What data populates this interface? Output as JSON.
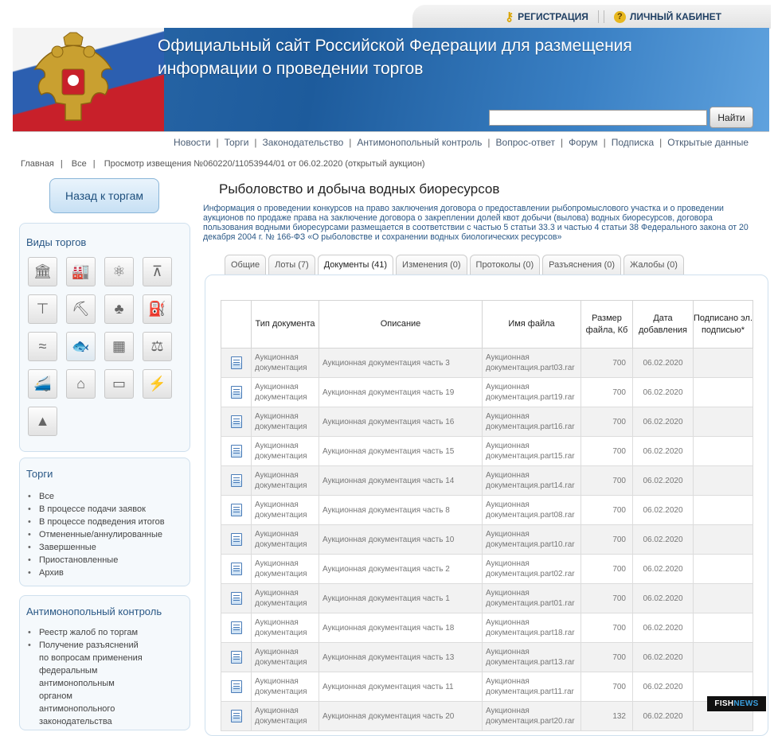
{
  "topbar": {
    "register": "РЕГИСТРАЦИЯ",
    "cabinet": "ЛИЧНЫЙ КАБИНЕТ"
  },
  "header": {
    "title_line1": "Официальный сайт Российской Федерации для размещения",
    "title_line2": "информации о проведении торгов",
    "search_button": "Найти"
  },
  "nav": [
    "Новости",
    "Торги",
    "Законодательство",
    "Антимонопольный контроль",
    "Вопрос-ответ",
    "Форум",
    "Подписка",
    "Открытые данные"
  ],
  "breadcrumb": [
    "Главная",
    "Все",
    "Просмотр извещения №060220/11053944/01 от 06.02.2020 (открытый аукцион)"
  ],
  "sidebar": {
    "back": "Назад к торгам",
    "types_title": "Виды торгов",
    "icons": [
      "building-icon",
      "factory-icon",
      "atom-icon",
      "surveyor-icon",
      "crane-icon",
      "miner-icon",
      "forest-icon",
      "oil-pump-icon",
      "water-icon",
      "fish-icon",
      "office-icon",
      "justice-icon",
      "train-icon",
      "house-icon",
      "billboard-icon",
      "power-line-icon",
      "antenna-icon"
    ],
    "torgi_title": "Торги",
    "torgi": [
      "Все",
      "В процессе подачи заявок",
      "В процессе подведения итогов",
      "Отмененные/аннулированные",
      "Завершенные",
      "Приостановленные",
      "Архив"
    ],
    "anti_title": "Антимонопольный контроль",
    "anti": [
      "Реестр жалоб по торгам",
      "Получение разъяснений по вопросам применения федеральным антимонопольным органом антимонопольного законодательства"
    ]
  },
  "main": {
    "title": "Рыболовство и добыча водных биоресурсов",
    "info": "Информация о проведении конкурсов на право заключения договора о предоставлении рыбопромыслового участка и о проведении аукционов по продаже права на заключение договора о закреплении долей квот добычи (вылова) водных биоресурсов, договора пользования водными биоресурсами размещается в соответствии с частью 5 статьи 33.3 и частью 4 статьи 38 Федерального закона от 20 декабря 2004 г. № 166-ФЗ «О рыболовстве и сохранении водных биологических ресурсов»",
    "tabs": [
      "Общие",
      "Лоты (7)",
      "Документы (41)",
      "Изменения (0)",
      "Протоколы (0)",
      "Разъяснения (0)",
      "Жалобы (0)"
    ],
    "active_tab": 2
  },
  "table": {
    "headers": [
      "",
      "Тип документа",
      "Описание",
      "Имя файла",
      "Размер файла, Кб",
      "Дата добавления",
      "Подписано эл. подписью*"
    ],
    "rows": [
      [
        "Аукционная документация",
        "Аукционная документация часть 3",
        "Аукционная документация.part03.rar",
        "700",
        "06.02.2020"
      ],
      [
        "Аукционная документация",
        "Аукционная документация часть 19",
        "Аукционная документация.part19.rar",
        "700",
        "06.02.2020"
      ],
      [
        "Аукционная документация",
        "Аукционная документация часть 16",
        "Аукционная документация.part16.rar",
        "700",
        "06.02.2020"
      ],
      [
        "Аукционная документация",
        "Аукционная документация часть 15",
        "Аукционная документация.part15.rar",
        "700",
        "06.02.2020"
      ],
      [
        "Аукционная документация",
        "Аукционная документация часть 14",
        "Аукционная документация.part14.rar",
        "700",
        "06.02.2020"
      ],
      [
        "Аукционная документация",
        "Аукционная документация часть 8",
        "Аукционная документация.part08.rar",
        "700",
        "06.02.2020"
      ],
      [
        "Аукционная документация",
        "Аукционная документация часть 10",
        "Аукционная документация.part10.rar",
        "700",
        "06.02.2020"
      ],
      [
        "Аукционная документация",
        "Аукционная документация часть 2",
        "Аукционная документация.part02.rar",
        "700",
        "06.02.2020"
      ],
      [
        "Аукционная документация",
        "Аукционная документация часть 1",
        "Аукционная документация.part01.rar",
        "700",
        "06.02.2020"
      ],
      [
        "Аукционная документация",
        "Аукционная документация часть 18",
        "Аукционная документация.part18.rar",
        "700",
        "06.02.2020"
      ],
      [
        "Аукционная документация",
        "Аукционная документация часть 13",
        "Аукционная документация.part13.rar",
        "700",
        "06.02.2020"
      ],
      [
        "Аукционная документация",
        "Аукционная документация часть 11",
        "Аукционная документация.part11.rar",
        "700",
        "06.02.2020"
      ],
      [
        "Аукционная документация",
        "Аукционная документация часть 20",
        "Аукционная документация.part20.rar",
        "132",
        "06.02.2020"
      ]
    ]
  },
  "watermark": {
    "a": "FISH",
    "b": "NEWS"
  }
}
